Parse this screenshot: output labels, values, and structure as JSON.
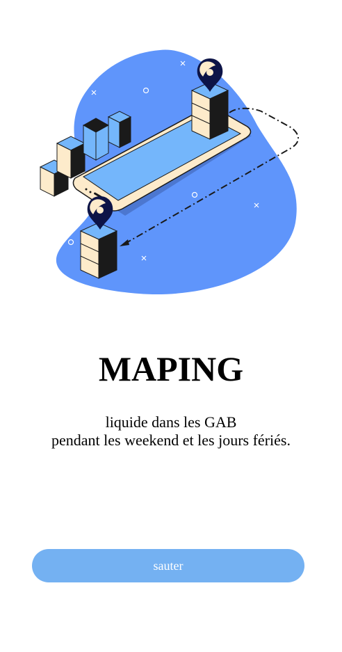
{
  "onboarding": {
    "title": "MAPING",
    "subtitle_line1": "liquide dans les GAB",
    "subtitle_line2": "pendant les weekend et les jours fériés.",
    "skip_label": "sauter"
  },
  "colors": {
    "blob": "#5f95fb",
    "screen": "#74b6fb",
    "phone_body": "#fdebcb",
    "button": "#74b1f2",
    "pin": "#0d1447"
  },
  "illustration": {
    "icons": [
      "map-pin-icon",
      "map-pin-icon",
      "building-icon",
      "route-path"
    ]
  }
}
